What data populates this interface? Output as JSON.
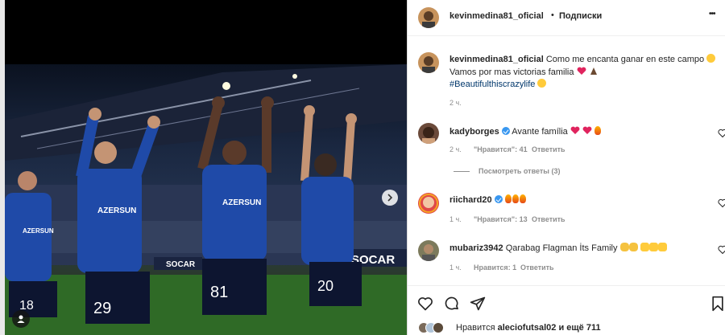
{
  "post": {
    "author": "kevinmedina81_oficial",
    "separator": "•",
    "follow_status": "Подписки",
    "more": "•••"
  },
  "caption": {
    "username": "kevinmedina81_oficial",
    "line1": "Como me encanta ganar en este campo",
    "line2": "Vamos por mas victorias familia",
    "hashtag": "#Beautifulthiscrazylife",
    "time": "2 ч."
  },
  "comments": [
    {
      "username": "kadyborges",
      "verified": true,
      "text": "Avante família",
      "time": "2 ч.",
      "likes": "\"Нравится\": 41",
      "reply": "Ответить"
    },
    {
      "username": "riichard20",
      "verified": true,
      "text": "",
      "time": "1 ч.",
      "likes": "\"Нравится\": 13",
      "reply": "Ответить"
    },
    {
      "username": "mubariz3942",
      "verified": false,
      "text": "Qarabag Flagman İts Family",
      "time": "1 ч.",
      "likes": "Нравится: 1",
      "reply": "Ответить"
    }
  ],
  "view_replies": "Посмотреть ответы (3)",
  "liked_by": {
    "prefix": "Нравится",
    "user": "aleciofutsal02",
    "suffix": "и ещё 711"
  },
  "photo_text": {
    "sponsor1": "AZERSUN",
    "sponsor2": "AZERSUN",
    "sponsor3": "AZERSUN",
    "board1": "SOCAR",
    "board2": "SOCAR",
    "num1": "18",
    "num2": "29",
    "num3": "81",
    "num4": "20"
  },
  "icons": {
    "heart": "heart-icon",
    "comment": "comment-icon",
    "share": "share-icon",
    "save": "bookmark-icon",
    "next": "chevron-right-icon",
    "tag": "user-tag-icon"
  },
  "colors": {
    "shirt": "#1f4aa8",
    "link": "#00376b",
    "verified": "#3897f0",
    "red_heart": "#e0245e"
  }
}
